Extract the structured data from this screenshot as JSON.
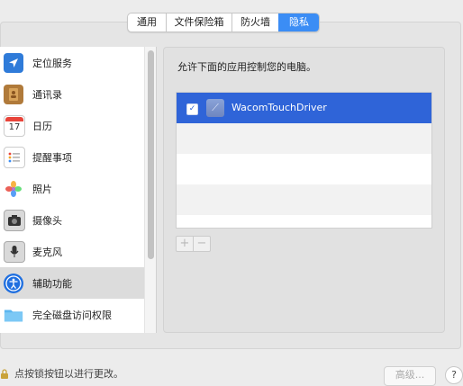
{
  "tabs": {
    "items": [
      {
        "label": "通用"
      },
      {
        "label": "文件保险箱"
      },
      {
        "label": "防火墙"
      },
      {
        "label": "隐私"
      }
    ],
    "selected": "隐私"
  },
  "sidebar": {
    "items": [
      {
        "label": "定位服务",
        "icon": "location-arrow-icon"
      },
      {
        "label": "通讯录",
        "icon": "contacts-book-icon"
      },
      {
        "label": "日历",
        "icon": "calendar-icon",
        "icon_text": "17"
      },
      {
        "label": "提醒事项",
        "icon": "reminders-list-icon"
      },
      {
        "label": "照片",
        "icon": "photos-flower-icon"
      },
      {
        "label": "摄像头",
        "icon": "camera-icon"
      },
      {
        "label": "麦克风",
        "icon": "microphone-icon"
      },
      {
        "label": "辅助功能",
        "icon": "accessibility-icon"
      },
      {
        "label": "完全磁盘访问权限",
        "icon": "folder-icon"
      }
    ],
    "selected": "辅助功能"
  },
  "content": {
    "description": "允许下面的应用控制您的电脑。",
    "apps": [
      {
        "name": "WacomTouchDriver",
        "checked": true,
        "selected": true,
        "icon": "app-icon"
      }
    ],
    "add_label": "+",
    "remove_label": "−"
  },
  "footer": {
    "lock_text": "点按锁按钮以进行更改。",
    "advanced_label": "高级...",
    "help_label": "?"
  },
  "colors": {
    "accent": "#3b8df5",
    "selection": "#2f64d8"
  }
}
